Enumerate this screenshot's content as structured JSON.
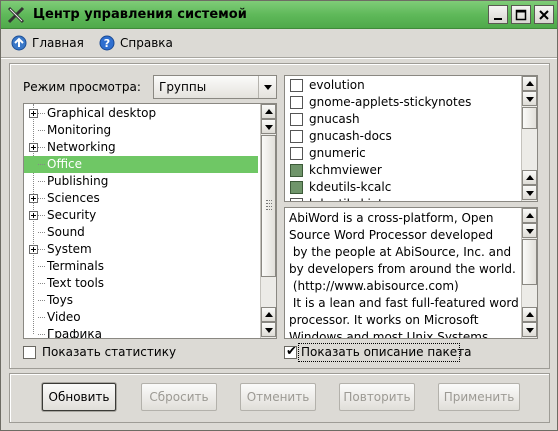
{
  "window": {
    "title": "Центр управления системой"
  },
  "menu": {
    "home_label": "Главная",
    "help_label": "Справка"
  },
  "view_mode": {
    "label": "Режим просмотра:",
    "selected": "Группы"
  },
  "groups": [
    {
      "label": "Graphical desktop",
      "expandable": true,
      "selected": false
    },
    {
      "label": "Monitoring",
      "expandable": false,
      "selected": false
    },
    {
      "label": "Networking",
      "expandable": true,
      "selected": false
    },
    {
      "label": "Office",
      "expandable": false,
      "selected": true
    },
    {
      "label": "Publishing",
      "expandable": false,
      "selected": false
    },
    {
      "label": "Sciences",
      "expandable": true,
      "selected": false
    },
    {
      "label": "Security",
      "expandable": true,
      "selected": false
    },
    {
      "label": "Sound",
      "expandable": false,
      "selected": false
    },
    {
      "label": "System",
      "expandable": true,
      "selected": false
    },
    {
      "label": "Terminals",
      "expandable": false,
      "selected": false
    },
    {
      "label": "Text tools",
      "expandable": false,
      "selected": false
    },
    {
      "label": "Toys",
      "expandable": false,
      "selected": false
    },
    {
      "label": "Video",
      "expandable": false,
      "selected": false
    },
    {
      "label": "Графика",
      "expandable": false,
      "selected": false
    }
  ],
  "packages": [
    {
      "name": "evolution",
      "installed": false
    },
    {
      "name": "gnome-applets-stickynotes",
      "installed": false
    },
    {
      "name": "gnucash",
      "installed": false
    },
    {
      "name": "gnucash-docs",
      "installed": false
    },
    {
      "name": "gnumeric",
      "installed": false
    },
    {
      "name": "kchmviewer",
      "installed": true
    },
    {
      "name": "kdeutils-kcalc",
      "installed": true
    },
    {
      "name": "kdeutils-kjots",
      "installed": false
    }
  ],
  "description_lines": [
    "AbiWord is a cross-platform, Open",
    "Source Word Processor developed",
    " by the people at AbiSource, Inc. and",
    "by developers from around the world.",
    " (http://www.abisource.com)",
    " It is a lean and fast full-featured word",
    "processor. It works on Microsoft",
    "Windows and most Unix Systems."
  ],
  "options": {
    "show_stats_label": "Показать статистику",
    "show_stats_checked": false,
    "show_desc_label": "Показать описание пакета",
    "show_desc_checked": true
  },
  "buttons": {
    "refresh": "Обновить",
    "reset": "Сбросить",
    "cancel": "Отменить",
    "repeat": "Повторить",
    "apply": "Применить"
  },
  "colors": {
    "titlebar": "#5fb95a",
    "selection": "#6fc765",
    "window_bg": "#dcdad5",
    "installed_checkbox": "#6f956a"
  }
}
